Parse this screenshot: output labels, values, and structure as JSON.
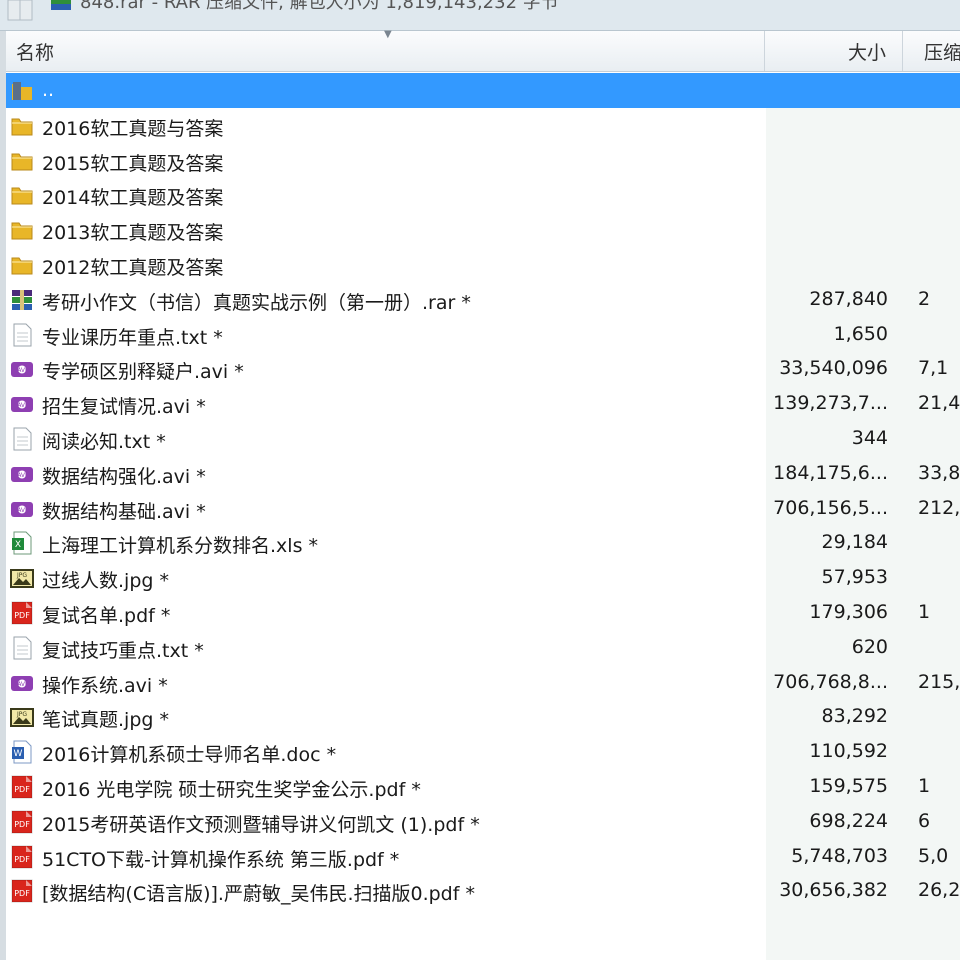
{
  "window": {
    "title": "848.rar - RAR 压缩文件, 解包大小为 1,819,143,232 字节"
  },
  "columns": {
    "name": "名称",
    "size": "大小",
    "packed": "压缩"
  },
  "files": [
    {
      "name": "..",
      "type": "up",
      "size": "",
      "packed": "",
      "selected": true
    },
    {
      "name": "2016软工真题与答案",
      "type": "folder",
      "size": "",
      "packed": ""
    },
    {
      "name": "2015软工真题及答案",
      "type": "folder",
      "size": "",
      "packed": ""
    },
    {
      "name": "2014软工真题及答案",
      "type": "folder",
      "size": "",
      "packed": ""
    },
    {
      "name": "2013软工真题及答案",
      "type": "folder",
      "size": "",
      "packed": ""
    },
    {
      "name": "2012软工真题及答案",
      "type": "folder",
      "size": "",
      "packed": ""
    },
    {
      "name": "考研小作文（书信）真题实战示例（第一册）.rar *",
      "type": "rar",
      "size": "287,840",
      "packed": "2"
    },
    {
      "name": "专业课历年重点.txt *",
      "type": "txt",
      "size": "1,650",
      "packed": ""
    },
    {
      "name": "专学硕区别释疑户.avi *",
      "type": "avi",
      "size": "33,540,096",
      "packed": "7,1"
    },
    {
      "name": "招生复试情况.avi *",
      "type": "avi",
      "size": "139,273,7...",
      "packed": "21,4"
    },
    {
      "name": "阅读必知.txt *",
      "type": "txt",
      "size": "344",
      "packed": ""
    },
    {
      "name": "数据结构强化.avi *",
      "type": "avi",
      "size": "184,175,6...",
      "packed": "33,8"
    },
    {
      "name": "数据结构基础.avi *",
      "type": "avi",
      "size": "706,156,5...",
      "packed": "212,("
    },
    {
      "name": "上海理工计算机系分数排名.xls *",
      "type": "xls",
      "size": "29,184",
      "packed": ""
    },
    {
      "name": "过线人数.jpg *",
      "type": "jpg",
      "size": "57,953",
      "packed": ""
    },
    {
      "name": "复试名单.pdf *",
      "type": "pdf",
      "size": "179,306",
      "packed": "1"
    },
    {
      "name": "复试技巧重点.txt *",
      "type": "txt",
      "size": "620",
      "packed": ""
    },
    {
      "name": "操作系统.avi *",
      "type": "avi",
      "size": "706,768,8...",
      "packed": "215,("
    },
    {
      "name": "笔试真题.jpg *",
      "type": "jpg",
      "size": "83,292",
      "packed": ""
    },
    {
      "name": "2016计算机系硕士导师名单.doc *",
      "type": "doc",
      "size": "110,592",
      "packed": ""
    },
    {
      "name": "2016 光电学院 硕士研究生奖学金公示.pdf *",
      "type": "pdf",
      "size": "159,575",
      "packed": "1"
    },
    {
      "name": "2015考研英语作文预测暨辅导讲义何凯文 (1).pdf *",
      "type": "pdf",
      "size": "698,224",
      "packed": "6"
    },
    {
      "name": "51CTO下载-计算机操作系统 第三版.pdf *",
      "type": "pdf",
      "size": "5,748,703",
      "packed": "5,0"
    },
    {
      "name": "[数据结构(C语言版)].严蔚敏_吴伟民.扫描版0.pdf *",
      "type": "pdf",
      "size": "30,656,382",
      "packed": "26,2"
    }
  ],
  "colors": {
    "selection": "#3399ff",
    "folder": "#e8b628",
    "pdf": "#d9251c",
    "avi": "#8e3fb2",
    "xls": "#1f8a3a",
    "doc": "#2b5fb0",
    "jpg": "#3a3a1a"
  },
  "icons": {
    "up": "folder-up-icon",
    "folder": "folder-icon",
    "rar": "rar-archive-icon",
    "txt": "text-file-icon",
    "avi": "video-file-icon",
    "xls": "excel-file-icon",
    "jpg": "image-file-icon",
    "pdf": "pdf-file-icon",
    "doc": "word-file-icon"
  }
}
